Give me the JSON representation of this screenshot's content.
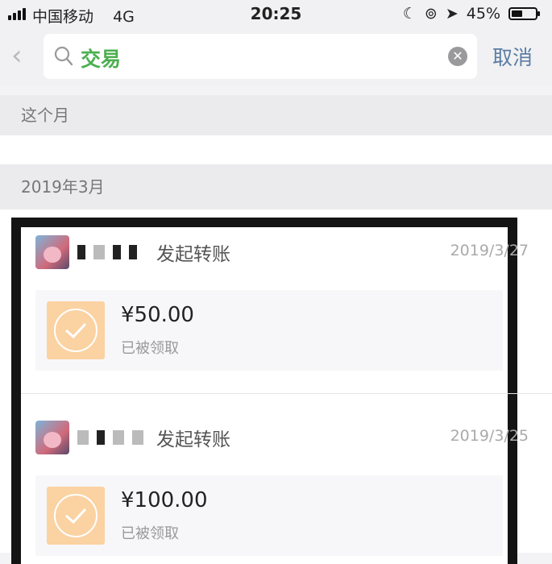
{
  "status_bar": {
    "carrier": "中国移动",
    "network": "4G",
    "time": "20:25",
    "battery": "45%",
    "battery_level": 0.45
  },
  "search": {
    "query": "交易",
    "cancel_label": "取消"
  },
  "sections": [
    {
      "label": "这个月"
    },
    {
      "label": "2019年3月"
    }
  ],
  "records": [
    {
      "title": "发起转账",
      "date": "2019/3/27",
      "amount": "¥50.00",
      "status": "已被领取"
    },
    {
      "title": "发起转账",
      "date": "2019/3/25",
      "amount": "¥100.00",
      "status": "已被领取"
    }
  ],
  "colors": {
    "query": "#4caf50",
    "cancel": "#5a7da3",
    "check_bg": "#fbd2a2"
  }
}
